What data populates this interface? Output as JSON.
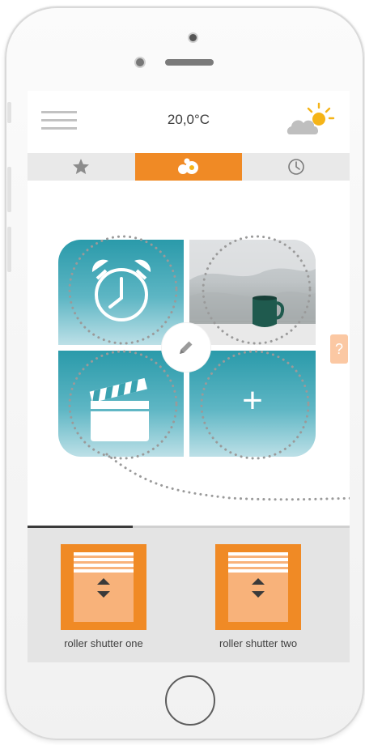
{
  "header": {
    "temperature": "20,0°C",
    "weather_icon": "partly-cloudy-sun-icon",
    "menu_icon": "hamburger-menu-icon"
  },
  "tabs": [
    {
      "name": "favorites",
      "icon": "star-icon",
      "active": false
    },
    {
      "name": "scenes",
      "icon": "scene-group-icon",
      "active": true
    },
    {
      "name": "timers",
      "icon": "clock-icon",
      "active": false
    }
  ],
  "scenes": {
    "tiles": [
      {
        "icon": "alarm-clock-icon"
      },
      {
        "icon": "coffee-cup-photo"
      },
      {
        "icon": "clapperboard-icon"
      },
      {
        "icon": "plus-icon",
        "label": "+"
      }
    ],
    "edit_icon": "pencil-icon",
    "help_label": "?"
  },
  "devices": [
    {
      "label": "roller shutter one",
      "icon": "roller-shutter-icon"
    },
    {
      "label": "roller shutter two",
      "icon": "roller-shutter-icon"
    }
  ],
  "colors": {
    "accent": "#f08a25",
    "teal": "#2a9aaa",
    "tab_bar": "#e9e9e9",
    "device_panel": "#e4e4e4"
  }
}
